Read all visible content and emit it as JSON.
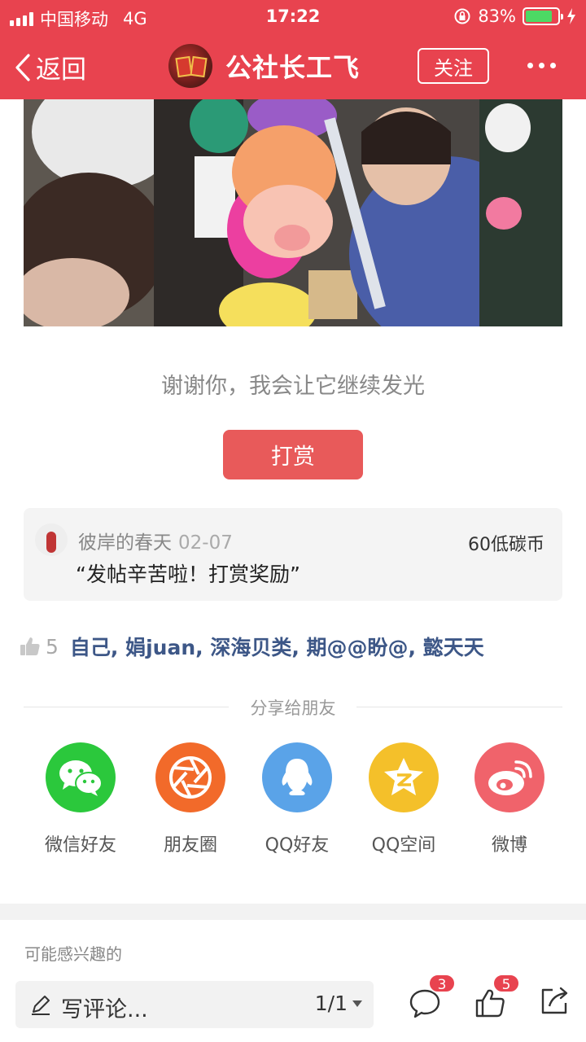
{
  "status_bar": {
    "carrier": "中国移动",
    "network": "4G",
    "time": "17:22",
    "battery": "83%",
    "battery_level": 0.83
  },
  "nav": {
    "back_label": "返回",
    "title": "公社长工飞",
    "follow_label": "关注"
  },
  "post": {
    "thanks_text": "谢谢你，我会让它继续发光",
    "reward_button": "打赏"
  },
  "reward_record": {
    "user": "彼岸的春天",
    "date": "02-07",
    "amount": "60低碳币",
    "message": "“发帖辛苦啦！打赏奖励”"
  },
  "likes": {
    "count": "5",
    "names": "自己, 娟juan, 深海贝类, 期@@盼@, 懿天天"
  },
  "share": {
    "title": "分享给朋友",
    "items": [
      {
        "label": "微信好友",
        "icon": "wechat-icon",
        "color": "#2bc83c"
      },
      {
        "label": "朋友圈",
        "icon": "moments-icon",
        "color": "#f26a2a"
      },
      {
        "label": "QQ好友",
        "icon": "qq-icon",
        "color": "#5aa3e8"
      },
      {
        "label": "QQ空间",
        "icon": "qzone-icon",
        "color": "#f4c02a"
      },
      {
        "label": "微博",
        "icon": "weibo-icon",
        "color": "#f0636b"
      }
    ]
  },
  "section": {
    "interest_title": "可能感兴趣的"
  },
  "bottom_bar": {
    "comment_placeholder": "写评论...",
    "pager": "1/1",
    "comment_count": "3",
    "like_count": "5"
  },
  "colors": {
    "brand": "#e8434f",
    "reward_button": "#e85a5a",
    "name_link": "#3d5787"
  }
}
